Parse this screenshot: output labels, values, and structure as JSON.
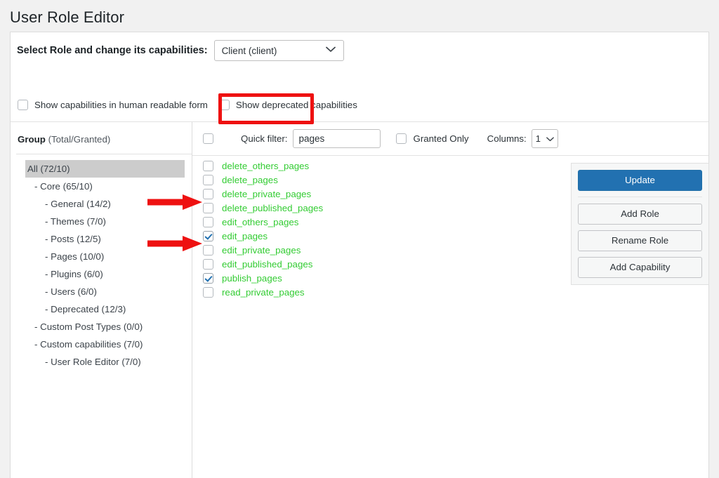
{
  "page": {
    "title": "User Role Editor"
  },
  "role_section": {
    "label": "Select Role and change its capabilities:",
    "selected_role": "Client (client)",
    "options": [
      {
        "label": "Show capabilities in human readable form",
        "checked": false
      },
      {
        "label": "Show deprecated capabilities",
        "checked": false
      }
    ]
  },
  "group_panel": {
    "header_bold": "Group",
    "header_rest": " (Total/Granted)",
    "items": [
      {
        "label": "All (72/10)",
        "level": 0,
        "selected": true
      },
      {
        "label": "- Core (65/10)",
        "level": 1,
        "selected": false
      },
      {
        "label": "- General (14/2)",
        "level": 2,
        "selected": false
      },
      {
        "label": "- Themes (7/0)",
        "level": 2,
        "selected": false
      },
      {
        "label": "- Posts (12/5)",
        "level": 2,
        "selected": false
      },
      {
        "label": "- Pages (10/0)",
        "level": 2,
        "selected": false
      },
      {
        "label": "- Plugins (6/0)",
        "level": 2,
        "selected": false
      },
      {
        "label": "- Users (6/0)",
        "level": 2,
        "selected": false
      },
      {
        "label": "- Deprecated (12/3)",
        "level": 2,
        "selected": false
      },
      {
        "label": "- Custom Post Types (0/0)",
        "level": 1,
        "selected": false
      },
      {
        "label": "- Custom capabilities (7/0)",
        "level": 1,
        "selected": false
      },
      {
        "label": "- User Role Editor (7/0)",
        "level": 2,
        "selected": false
      }
    ]
  },
  "toolbar": {
    "select_all_checked": false,
    "quick_filter_label": "Quick filter:",
    "quick_filter_value": "pages",
    "quick_filter_placeholder": "",
    "granted_only_label": "Granted Only",
    "granted_only_checked": false,
    "columns_label": "Columns:",
    "columns_value": "1"
  },
  "capabilities": [
    {
      "name": "delete_others_pages",
      "granted": false
    },
    {
      "name": "delete_pages",
      "granted": false
    },
    {
      "name": "delete_private_pages",
      "granted": false
    },
    {
      "name": "delete_published_pages",
      "granted": false
    },
    {
      "name": "edit_others_pages",
      "granted": false
    },
    {
      "name": "edit_pages",
      "granted": true
    },
    {
      "name": "edit_private_pages",
      "granted": false
    },
    {
      "name": "edit_published_pages",
      "granted": false
    },
    {
      "name": "publish_pages",
      "granted": true
    },
    {
      "name": "read_private_pages",
      "granted": false
    }
  ],
  "actions": {
    "update_label": "Update",
    "add_role_label": "Add Role",
    "rename_role_label": "Rename Role",
    "add_capability_label": "Add Capability"
  },
  "annotations": {
    "highlight_target": "quick-filter",
    "arrow_targets": [
      "edit_pages",
      "publish_pages"
    ],
    "color": "#ee1111"
  },
  "colors": {
    "page_background": "#f1f1f1",
    "panel_background": "#ffffff",
    "capability_text": "#33cc33",
    "primary_button": "#2271b1",
    "selected_row": "#cccccc",
    "annotation_red": "#ee1111"
  }
}
